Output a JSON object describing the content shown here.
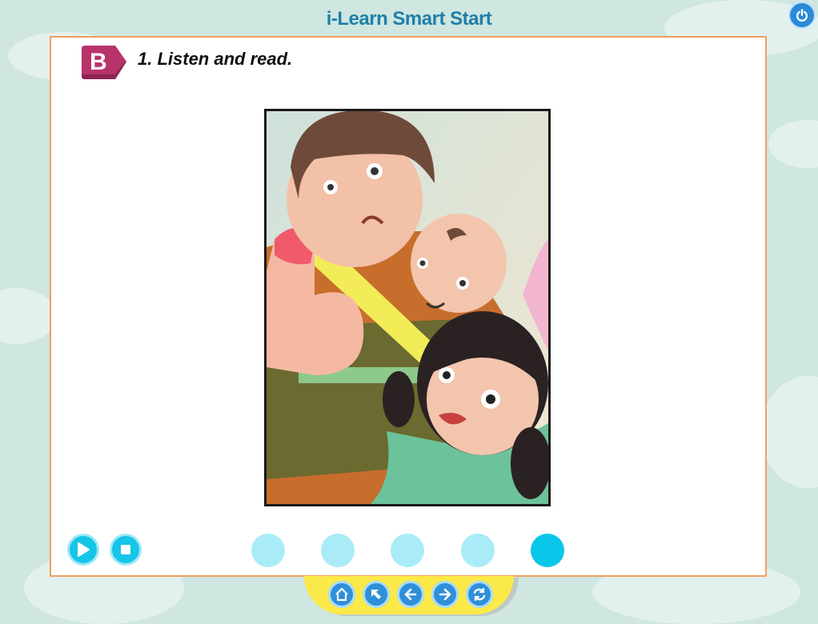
{
  "app": {
    "title": "i-Learn Smart Start",
    "power_icon": "power-icon"
  },
  "lesson": {
    "section_badge": "B",
    "instruction": "1. Listen and read."
  },
  "illustration": {
    "alt_icon": "family-illustration"
  },
  "controls": {
    "play_icon": "play-icon",
    "stop_icon": "stop-icon",
    "page_dots": [
      {
        "active": false
      },
      {
        "active": false
      },
      {
        "active": false
      },
      {
        "active": false
      },
      {
        "active": true
      }
    ]
  },
  "navigation": {
    "buttons": [
      "home-icon",
      "up-left-arrow-icon",
      "back-arrow-icon",
      "forward-arrow-icon",
      "refresh-icon"
    ]
  },
  "colors": {
    "accent_cyan": "#08c7ea",
    "title_blue": "#1f7fa8",
    "badge_magenta": "#b8336a",
    "panel_border": "#f0a060",
    "nav_yellow": "#fbe94a"
  }
}
